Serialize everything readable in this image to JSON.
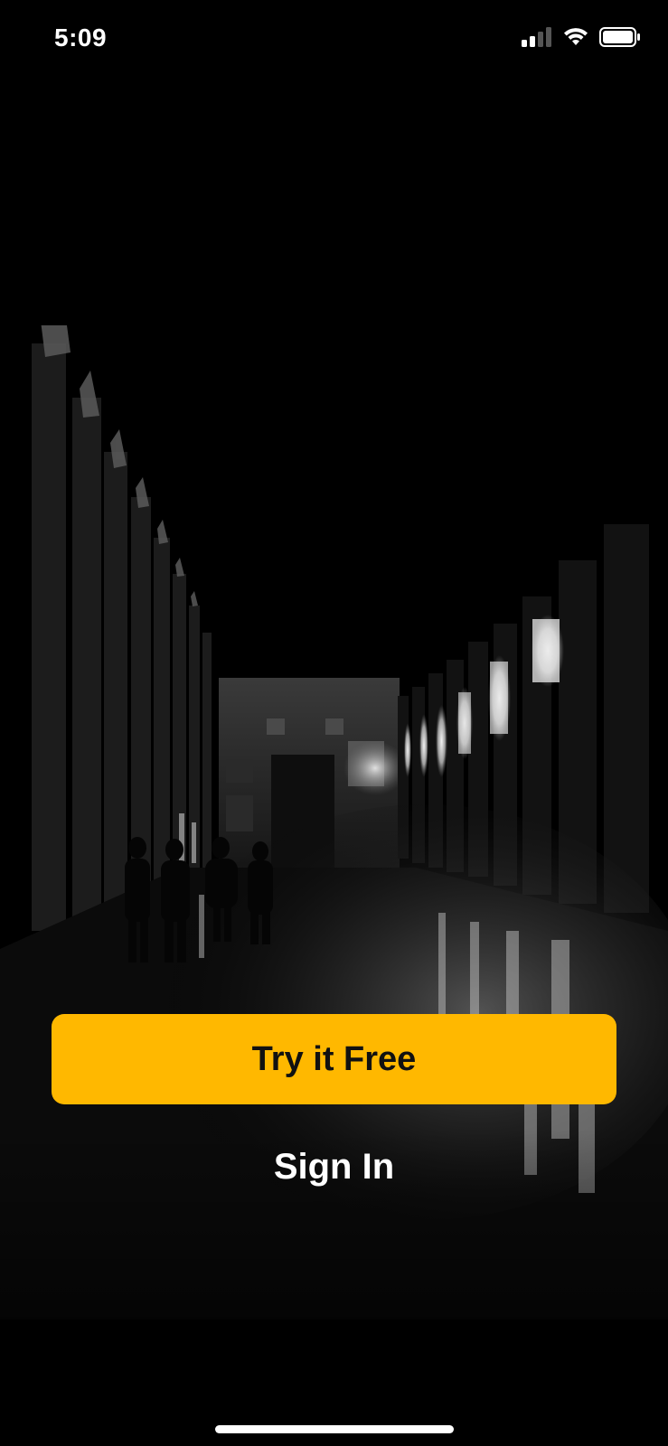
{
  "status_bar": {
    "time": "5:09",
    "signal_icon": "cellular-signal-icon",
    "wifi_icon": "wifi-icon",
    "battery_icon": "battery-icon"
  },
  "hero": {
    "image": "dark-colonnade-photo"
  },
  "actions": {
    "primary_label": "Try it Free",
    "secondary_label": "Sign In"
  },
  "colors": {
    "background": "#000000",
    "accent": "#FFB800",
    "primary_text": "#111111",
    "secondary_text": "#FFFFFF"
  }
}
